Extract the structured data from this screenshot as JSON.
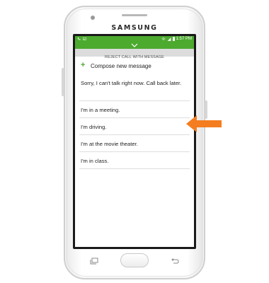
{
  "device": {
    "brand": "SAMSUNG"
  },
  "statusbar": {
    "time": "1:57 PM",
    "left_icons": [
      "phone-call-icon",
      "image-icon"
    ],
    "right_icons": [
      "wifi-icon",
      "signal-icon",
      "battery-icon"
    ],
    "color": "#4caa2f"
  },
  "reject_panel": {
    "header": "REJECT CALL WITH MESSAGE",
    "compose_label": "Compose new message",
    "compose_icon": "plus-icon",
    "messages": [
      "Sorry, I can't talk right now. Call back later.",
      "I'm in a meeting.",
      "I'm driving.",
      "I'm at the movie theater.",
      "I'm in class."
    ]
  },
  "annotation": {
    "arrow_color": "#f47d20",
    "points_to": "messages"
  }
}
